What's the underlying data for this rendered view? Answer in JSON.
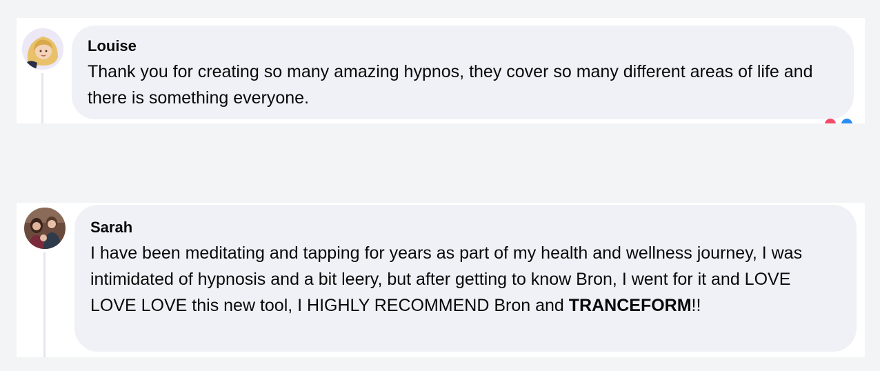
{
  "comments": [
    {
      "author": "Louise",
      "text": "Thank you for creating so many amazing hypnos, they cover so many different areas of life and there is something everyone."
    },
    {
      "author": "Sarah",
      "text": "I have been meditating and tapping for years as part of my health and wellness journey, I was intimidated of hypnosis and a bit leery, but after getting to know Bron, I went for it and LOVE LOVE LOVE this new tool, I HIGHLY RECOMMEND Bron and ",
      "text_bold": "TRANCEFORM",
      "text_end": "!!"
    }
  ],
  "colors": {
    "page_background": "#f3f4f5",
    "card_background": "#ffffff",
    "bubble_background": "#f0f1f6",
    "reaction_love": "#f44a6a",
    "reaction_like": "#2b8cf4"
  },
  "icons": [
    "love-reaction-icon",
    "like-reaction-icon"
  ]
}
